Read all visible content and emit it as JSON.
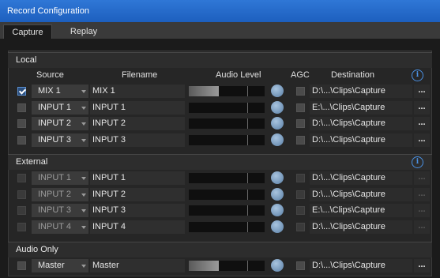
{
  "window": {
    "title": "Record Configuration"
  },
  "tabs": [
    {
      "label": "Capture",
      "active": true
    },
    {
      "label": "Replay",
      "active": false
    }
  ],
  "columns": {
    "source": "Source",
    "filename": "Filename",
    "audio_level": "Audio Level",
    "agc": "AGC",
    "destination": "Destination"
  },
  "icons": {
    "info": "info-icon",
    "browse": "ellipsis-browse-icon",
    "check": "checkmark-icon",
    "dropdown": "chevron-down-icon"
  },
  "colors": {
    "titlebar": "#2166c8",
    "accent": "#4a90e2",
    "knob": "#7fa3c8"
  },
  "sections": {
    "local": {
      "title": "Local",
      "rows": [
        {
          "enabled": true,
          "source": "MIX 1",
          "filename": "MIX 1",
          "audio_level": 0.4,
          "destination": "D:\\...\\Clips\\Capture",
          "browse": "..."
        },
        {
          "enabled": false,
          "source": "INPUT 1",
          "filename": "INPUT 1",
          "audio_level": 0.0,
          "destination": "E:\\...\\Clips\\Capture",
          "browse": "..."
        },
        {
          "enabled": false,
          "source": "INPUT 2",
          "filename": "INPUT 2",
          "audio_level": 0.0,
          "destination": "D:\\...\\Clips\\Capture",
          "browse": "..."
        },
        {
          "enabled": false,
          "source": "INPUT 3",
          "filename": "INPUT 3",
          "audio_level": 0.0,
          "destination": "D:\\...\\Clips\\Capture",
          "browse": "..."
        }
      ]
    },
    "external": {
      "title": "External",
      "rows": [
        {
          "enabled": false,
          "source": "INPUT 1",
          "filename": "INPUT 1",
          "audio_level": 0.0,
          "destination": "D:\\...\\Clips\\Capture",
          "browse": "..."
        },
        {
          "enabled": false,
          "source": "INPUT 2",
          "filename": "INPUT 2",
          "audio_level": 0.0,
          "destination": "D:\\...\\Clips\\Capture",
          "browse": "..."
        },
        {
          "enabled": false,
          "source": "INPUT 3",
          "filename": "INPUT 3",
          "audio_level": 0.0,
          "destination": "E:\\...\\Clips\\Capture",
          "browse": "..."
        },
        {
          "enabled": false,
          "source": "INPUT 4",
          "filename": "INPUT 4",
          "audio_level": 0.0,
          "destination": "D:\\...\\Clips\\Capture",
          "browse": "..."
        }
      ]
    },
    "audio_only": {
      "title": "Audio Only",
      "rows": [
        {
          "enabled": false,
          "source": "Master",
          "filename": "Master",
          "audio_level": 0.4,
          "destination": "D:\\...\\Clips\\Capture",
          "browse": "..."
        }
      ]
    }
  }
}
